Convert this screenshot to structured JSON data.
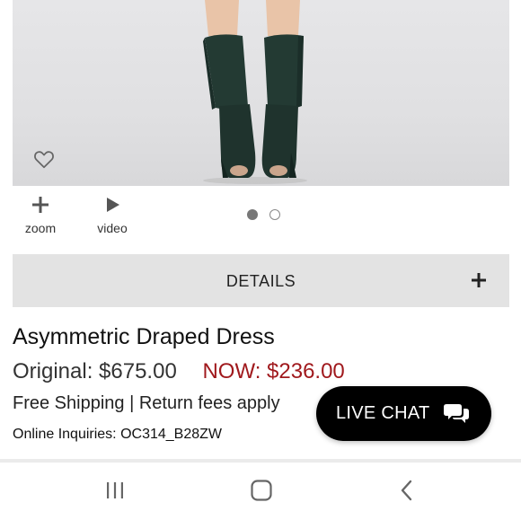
{
  "product_media": {
    "image_icon": "boot-photo",
    "wishlist_icon": "heart-outline-icon",
    "zoom": {
      "icon": "plus-icon",
      "label": "zoom"
    },
    "video": {
      "icon": "play-icon",
      "label": "video"
    },
    "carousel": {
      "total": 2,
      "active_index": 0
    }
  },
  "details": {
    "label": "DETAILS",
    "icon": "plus-icon"
  },
  "product": {
    "title": "Asymmetric Draped Dress",
    "original_price": "Original: $675.00",
    "now_price": "NOW: $236.00",
    "shipping": "Free Shipping | Return fees apply",
    "inquiries": "Online Inquiries: OC314_B28ZW"
  },
  "live_chat": {
    "label": "LIVE CHAT",
    "icon": "chat-bubbles-icon"
  },
  "system_nav": {
    "recents_icon": "recents-icon",
    "home_icon": "home-icon",
    "back_icon": "back-icon"
  },
  "colors": {
    "sale_price": "#a0191d",
    "details_bar": "#e3e3e3",
    "live_chat_bg": "#000000"
  }
}
